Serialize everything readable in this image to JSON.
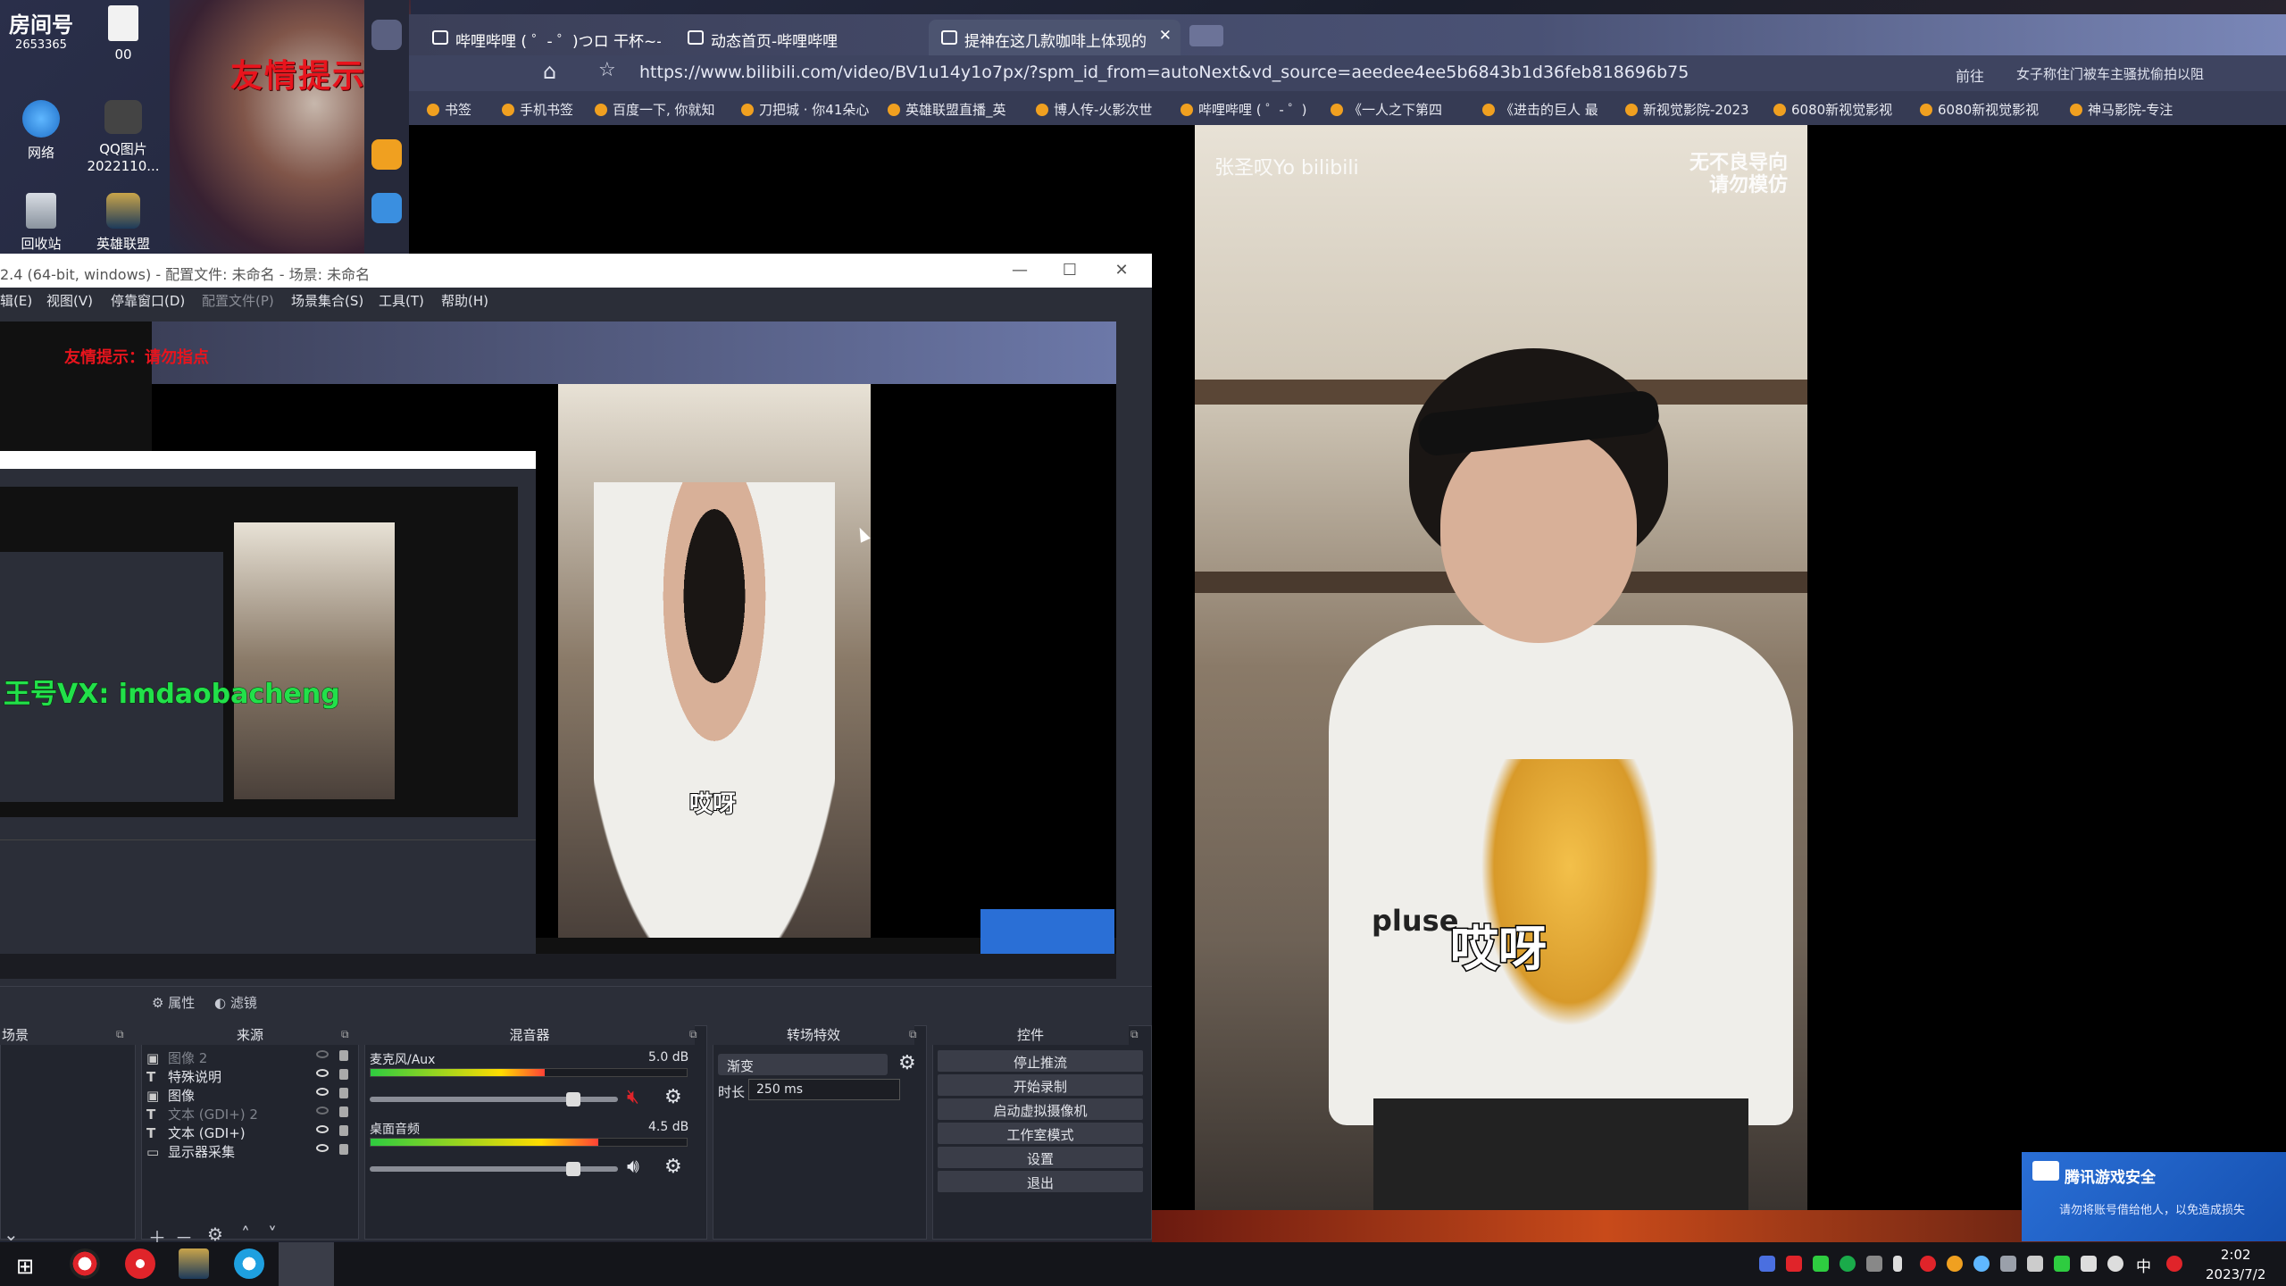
{
  "desktop": {
    "icons": [
      {
        "label": "房间号\n2653365",
        "top": 0
      },
      {
        "label": "00",
        "top": 0
      },
      {
        "label": "网络",
        "top": 0
      },
      {
        "label": "QQ图片2022110...",
        "top": 0
      },
      {
        "label": "回收站",
        "top": 0
      },
      {
        "label": "英雄联盟",
        "top": 0
      }
    ],
    "room_label": "房间号",
    "room_number": "2653365",
    "icon_00": "00",
    "icon_network": "网络",
    "icon_qq": "QQ图片",
    "icon_qq_sub": "2022110...",
    "icon_recycle": "回收站",
    "icon_lol": "英雄联盟",
    "warning": "友情提示：请勿指点"
  },
  "browser": {
    "tabs": [
      {
        "label": "哔哩哔哩 ( ゜- ゜)つロ 干杯~-bili"
      },
      {
        "label": "动态首页-哔哩哔哩"
      },
      {
        "label": "提神在这几款咖啡上体现的"
      }
    ],
    "url": "https://www.bilibili.com/video/BV1u14y1o7px/?spm_id_from=autoNext&vd_source=aeedee4ee5b6843b1d36feb818696b75",
    "forward_label": "前往",
    "search_hint": "女子称住门被车主骚扰偷拍以阻",
    "bookmarks": [
      "书签",
      "手机书签",
      "百度一下, 你就知",
      "刀把城 · 你41朵心",
      "英雄联盟直播_英",
      "博人传-火影次世",
      "哔哩哔哩 ( ゜- ゜)",
      "《一人之下第四",
      "《进击的巨人 最",
      "新视觉影院-2023",
      "6080新视觉影视",
      "6080新视觉影视",
      "神马影院-专注"
    ]
  },
  "video": {
    "watermark_left": "张圣叹Yo bilibili",
    "watermark_right_1": "无不良导向",
    "watermark_right_2": "请勿模仿",
    "shirt_text": "pluse",
    "caption": "哎呀"
  },
  "toast": {
    "title": "腾讯游戏安全",
    "message": "请勿将账号借给他人，以免造成损失"
  },
  "obs": {
    "title": "2.4 (64-bit, windows) - 配置文件: 未命名 - 场景: 未命名",
    "menu": [
      "辑(E)",
      "视图(V)",
      "停靠窗口(D)",
      "配置文件(P)",
      "场景集合(S)",
      "工具(T)",
      "帮助(H)"
    ],
    "preview": {
      "warning": "友情提示：请勿指点",
      "caption": "哎呀",
      "green_text": "王号VX: imdaobacheng"
    },
    "props_label": "属性",
    "filters_label": "滤镜",
    "docks": {
      "scenes": "场景",
      "sources": "来源",
      "mixer": "混音器",
      "transitions": "转场特效",
      "controls": "控件"
    },
    "sources": [
      {
        "type": "img",
        "name": "图像 2",
        "hidden": true
      },
      {
        "type": "T",
        "name": "特殊说明",
        "hidden": false
      },
      {
        "type": "img",
        "name": "图像",
        "hidden": false
      },
      {
        "type": "T",
        "name": "文本 (GDI+) 2",
        "hidden": true
      },
      {
        "type": "T",
        "name": "文本 (GDI+)",
        "hidden": false
      },
      {
        "type": "mon",
        "name": "显示器采集",
        "hidden": false
      }
    ],
    "mixer": [
      {
        "name": "麦克风/Aux",
        "db": "5.0 dB",
        "muted": true,
        "level": 0.55,
        "volume": 0.82
      },
      {
        "name": "桌面音频",
        "db": "4.5 dB",
        "muted": false,
        "level": 0.72,
        "volume": 0.82
      }
    ],
    "transition": {
      "type": "渐变",
      "duration_label": "时长",
      "duration": "250 ms"
    },
    "controls": [
      "停止推流",
      "开始录制",
      "启动虚拟摄像机",
      "工作室模式",
      "设置",
      "退出"
    ]
  },
  "taskbar": {
    "ime": "中",
    "time": "2:02",
    "date": "2023/7/2"
  },
  "colors": {
    "warning_red": "#e8141d",
    "obs_bg": "#2b2e38",
    "tencent_blue": "#2a6fd6",
    "preview_green": "#22e04a"
  }
}
